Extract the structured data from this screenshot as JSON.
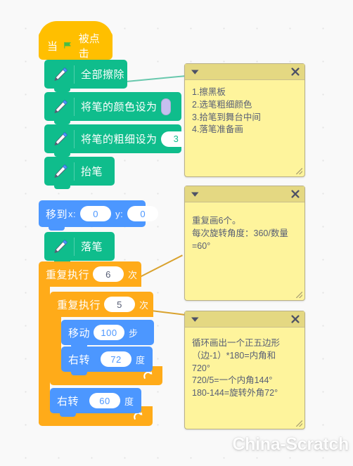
{
  "app": {
    "name": "Scratch 3 Code Area",
    "watermark": "China-Scratch"
  },
  "script": {
    "hat": {
      "prefix": "当",
      "icon": "green-flag-icon",
      "suffix": "被点击"
    },
    "blocks": [
      {
        "id": "erase-all",
        "category": "pen",
        "icon": "pen-icon",
        "label": "全部擦除"
      },
      {
        "id": "set-pen-color",
        "category": "pen",
        "icon": "pen-icon",
        "label": "将笔的颜色设为",
        "swatch": "#c6bfef"
      },
      {
        "id": "set-pen-size",
        "category": "pen",
        "icon": "pen-icon",
        "label": "将笔的粗细设为",
        "value": "3"
      },
      {
        "id": "pen-up",
        "category": "pen",
        "icon": "pen-icon",
        "label": "抬笔"
      },
      {
        "id": "go-to-xy",
        "category": "motion",
        "label": "移到",
        "x_label": "x:",
        "x_value": "0",
        "y_label": "y:",
        "y_value": "0"
      },
      {
        "id": "pen-down",
        "category": "pen",
        "icon": "pen-icon",
        "label": "落笔"
      },
      {
        "id": "repeat-outer",
        "category": "control",
        "label": "重复执行",
        "value": "6",
        "suffix": "次"
      },
      {
        "id": "repeat-inner",
        "category": "control",
        "label": "重复执行",
        "value": "5",
        "suffix": "次"
      },
      {
        "id": "move-steps",
        "category": "motion",
        "label": "移动",
        "value": "100",
        "suffix": "步"
      },
      {
        "id": "turn-right-72",
        "category": "motion",
        "label": "右转",
        "icon": "turn-right-icon",
        "value": "72",
        "suffix": "度"
      },
      {
        "id": "turn-right-60",
        "category": "motion",
        "label": "右转",
        "icon": "turn-right-icon",
        "value": "60",
        "suffix": "度"
      }
    ]
  },
  "comments": [
    {
      "id": "comment-setup",
      "collapse_icon": "chevron-down-icon",
      "close_icon": "close-icon",
      "text": "1.擦黑板\n2.选笔粗细颜色\n3.拾笔到舞台中间\n4.落笔准备画"
    },
    {
      "id": "comment-outer-loop",
      "collapse_icon": "chevron-down-icon",
      "close_icon": "close-icon",
      "text": "重复画6个。\n每次旋转角度：360/数量\n=60°"
    },
    {
      "id": "comment-inner-loop",
      "collapse_icon": "chevron-down-icon",
      "close_icon": "close-icon",
      "text": "循环画出一个正五边形\n（边-1）*180=内角和\n720°\n720/5=一个内角144°\n180-144=旋转外角72°"
    }
  ],
  "colors": {
    "pen": "#0fbd8c",
    "motion": "#4c97ff",
    "control": "#ffab19",
    "events": "#ffbf00",
    "comment_body": "#fef49c",
    "comment_head": "#e4d882",
    "canvas": "#f9f9f9"
  }
}
